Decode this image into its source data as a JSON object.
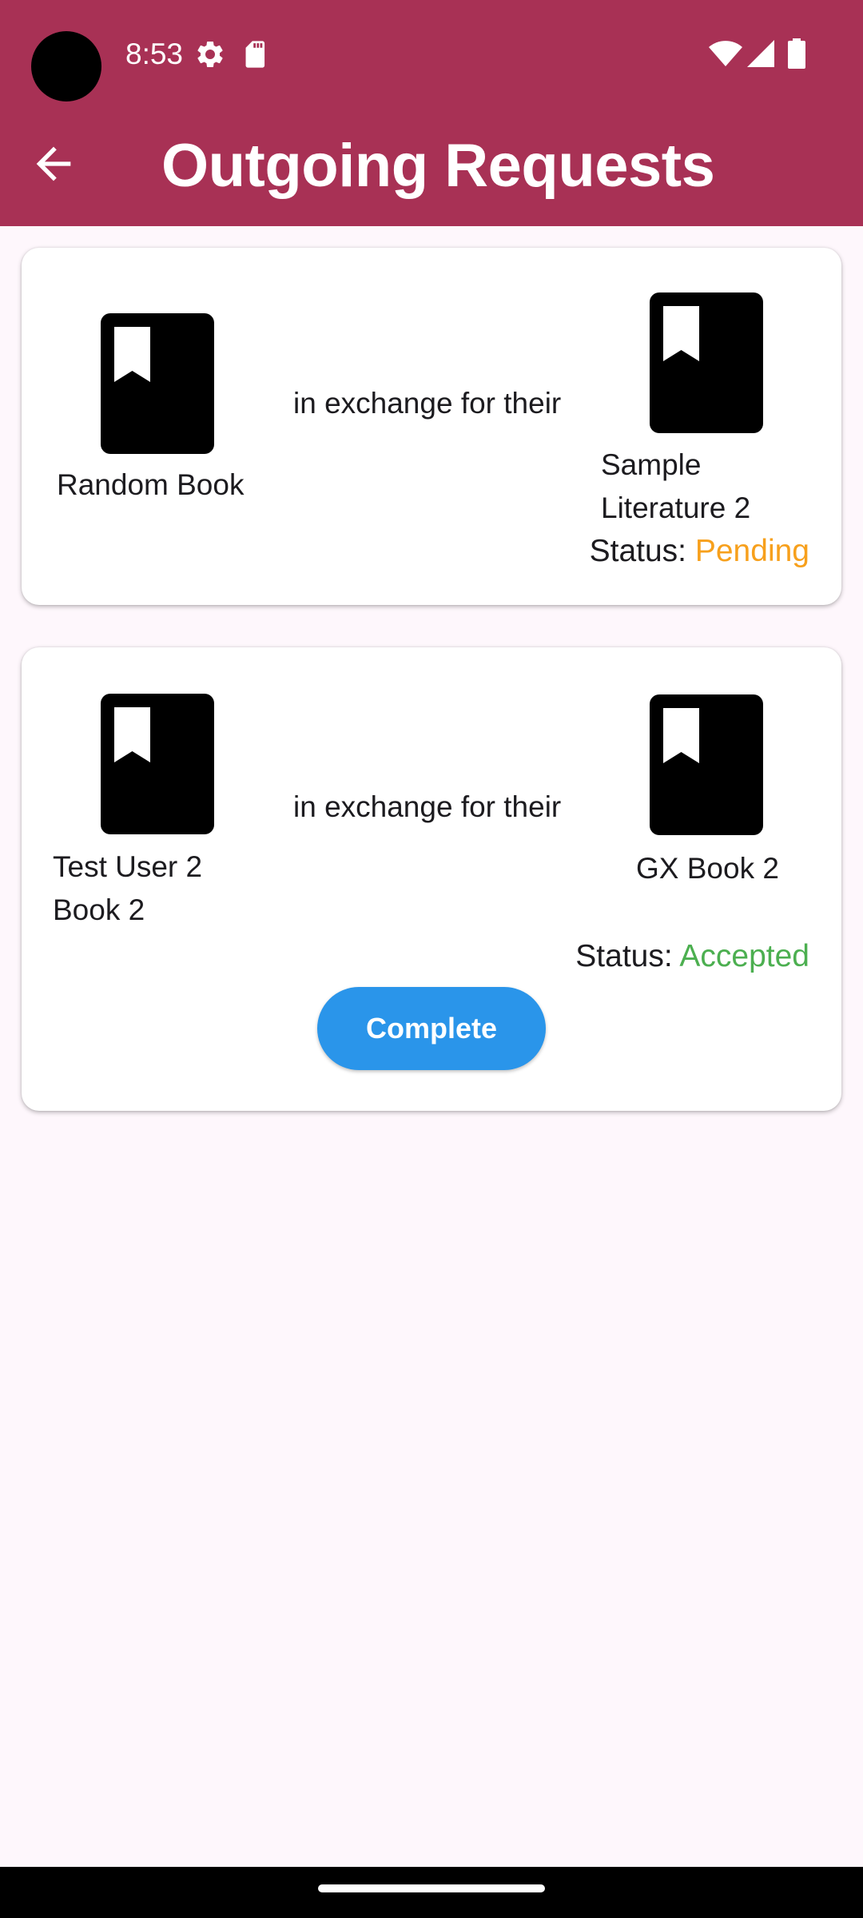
{
  "status_bar": {
    "time": "8:53",
    "icons": [
      "settings-gear-icon",
      "sd-card-icon",
      "wifi-icon",
      "cell-signal-icon",
      "battery-icon"
    ]
  },
  "app_bar": {
    "title": "Outgoing Requests",
    "back_icon": "arrow-back-icon"
  },
  "colors": {
    "app_bar": "#a83155",
    "background": "#fef7fc",
    "pending": "#f7a01c",
    "accepted": "#4caf50",
    "button": "#2a95ea"
  },
  "requests": [
    {
      "your_book": "Random Book",
      "exchange_text": "in exchange for their",
      "their_book_line1": "Sample",
      "their_book_line2": "Literature 2",
      "status_label": "Status:",
      "status_value": "Pending"
    },
    {
      "your_book_line1": "Test User 2",
      "your_book_line2": "Book 2",
      "exchange_text": "in exchange for their",
      "their_book": "GX Book 2",
      "status_label": "Status:",
      "status_value": "Accepted",
      "action_label": "Complete"
    }
  ]
}
